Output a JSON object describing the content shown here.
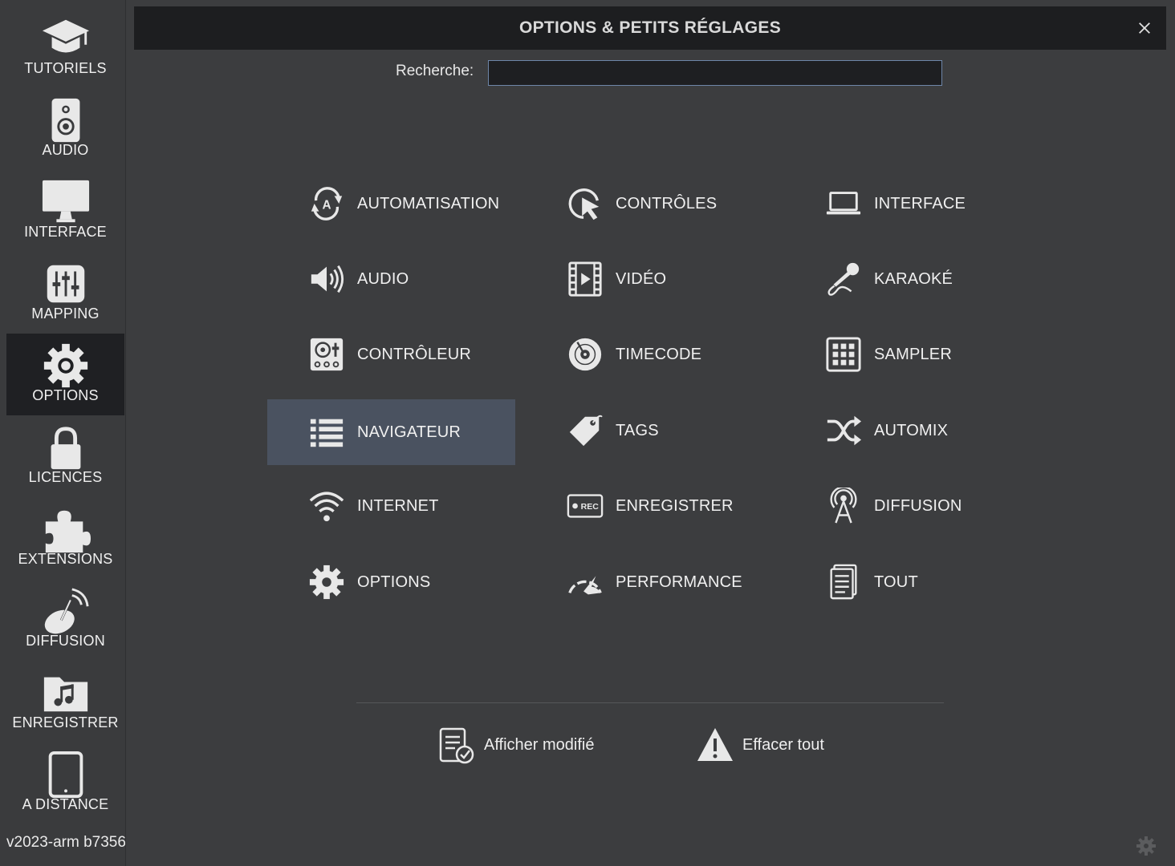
{
  "app_version": "v2023-arm b7356",
  "colors": {
    "selected_bg": "#4a5260",
    "active_sidebar_bg": "#1f2023",
    "search_border": "#6e86a8"
  },
  "sidebar": {
    "items": [
      {
        "label": "TUTORIELS",
        "icon": "graduation-cap-icon"
      },
      {
        "label": "AUDIO",
        "icon": "speaker-icon"
      },
      {
        "label": "INTERFACE",
        "icon": "monitor-icon"
      },
      {
        "label": "MAPPING",
        "icon": "mixer-faders-icon"
      },
      {
        "label": "OPTIONS",
        "icon": "gear-icon",
        "active": true
      },
      {
        "label": "LICENCES",
        "icon": "lock-icon"
      },
      {
        "label": "EXTENSIONS",
        "icon": "puzzle-icon"
      },
      {
        "label": "DIFFUSION",
        "icon": "satellite-dish-icon"
      },
      {
        "label": "ENREGISTRER",
        "icon": "music-folder-icon"
      },
      {
        "label": "A DISTANCE",
        "icon": "tablet-icon"
      }
    ]
  },
  "dialog": {
    "title": "OPTIONS & PETITS RÉGLAGES",
    "close_icon": "close-icon",
    "search": {
      "label": "Recherche:",
      "value": "",
      "placeholder": ""
    },
    "options": [
      {
        "label": "AUTOMATISATION",
        "icon": "automation-icon"
      },
      {
        "label": "CONTRÔLES",
        "icon": "cursor-click-icon"
      },
      {
        "label": "INTERFACE",
        "icon": "laptop-icon"
      },
      {
        "label": "AUDIO",
        "icon": "volume-icon"
      },
      {
        "label": "VIDÉO",
        "icon": "film-play-icon"
      },
      {
        "label": "KARAOKÉ",
        "icon": "microphone-icon"
      },
      {
        "label": "CONTRÔLEUR",
        "icon": "dj-controller-icon"
      },
      {
        "label": "TIMECODE",
        "icon": "vinyl-icon"
      },
      {
        "label": "SAMPLER",
        "icon": "pad-grid-icon"
      },
      {
        "label": "NAVIGATEUR",
        "icon": "list-icon",
        "selected": true
      },
      {
        "label": "TAGS",
        "icon": "tag-icon"
      },
      {
        "label": "AUTOMIX",
        "icon": "shuffle-icon"
      },
      {
        "label": "INTERNET",
        "icon": "wifi-icon"
      },
      {
        "label": "ENREGISTRER",
        "icon": "rec-icon",
        "icon_text": "REC"
      },
      {
        "label": "DIFFUSION",
        "icon": "broadcast-tower-icon"
      },
      {
        "label": "OPTIONS",
        "icon": "gear-icon"
      },
      {
        "label": "PERFORMANCE",
        "icon": "speedometer-icon"
      },
      {
        "label": "TOUT",
        "icon": "document-stack-icon"
      }
    ],
    "actions": [
      {
        "label": "Afficher modifié",
        "icon": "document-check-icon"
      },
      {
        "label": "Effacer tout",
        "icon": "warning-icon"
      }
    ]
  }
}
